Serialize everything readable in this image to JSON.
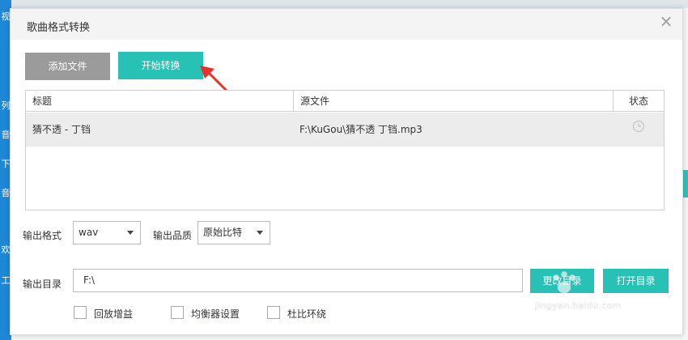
{
  "background": {
    "sidebar_items": [
      "视",
      "列",
      "音",
      "下",
      "音",
      "欢",
      "工"
    ]
  },
  "dialog": {
    "title": "歌曲格式转换",
    "close_symbol": "×"
  },
  "toolbar": {
    "add_file_label": "添加文件",
    "start_convert_label": "开始转换"
  },
  "table": {
    "columns": [
      "标题",
      "源文件",
      "状态"
    ],
    "rows": [
      {
        "title": "猜不透 - 丁铛",
        "source": "F:\\KuGou\\猜不透 丁铛.mp3",
        "status_icon": "clock-icon"
      }
    ]
  },
  "output": {
    "format_label": "输出格式",
    "format_value": "wav",
    "quality_label": "输出品质",
    "quality_value": "原始比特",
    "dir_label": "输出目录",
    "dir_value": "F:\\",
    "change_dir_label": "更改目录",
    "open_dir_label": "打开目录"
  },
  "options": {
    "replay_gain": "回放增益",
    "equalizer": "均衡器设置",
    "dolby": "杜比环绕"
  },
  "watermark": {
    "logo": "Baidu经验",
    "url": "jingyan.baidu.com"
  },
  "colors": {
    "accent": "#27c1b6",
    "secondary_button": "#9b9b9b",
    "sidebar": "#1e88d7",
    "arrow": "#e5332a"
  }
}
